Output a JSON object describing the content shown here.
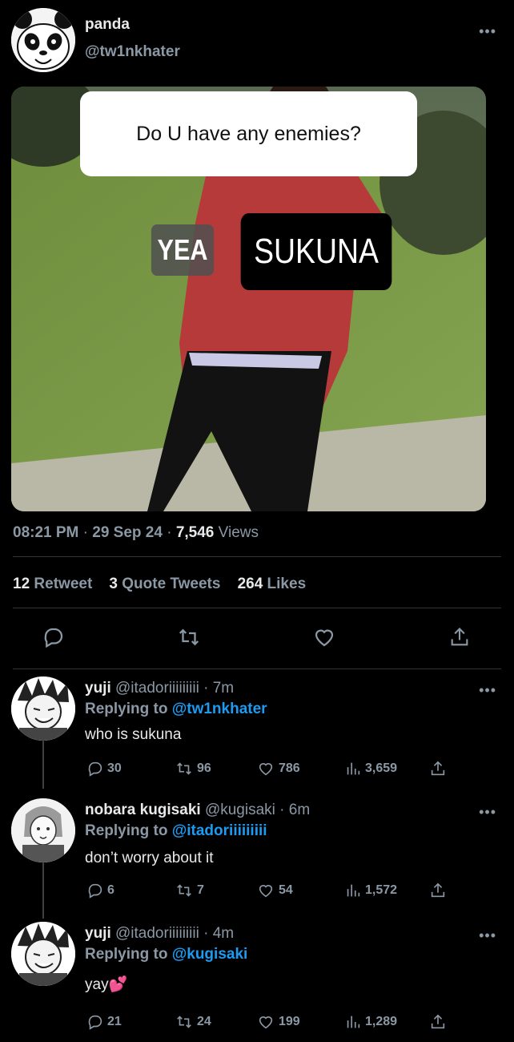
{
  "tweet": {
    "author_name": "panda",
    "author_handle": "@tw1nkhater",
    "media": {
      "question": "Do U have any enemies?",
      "answer_left": "YEA",
      "answer_right": "SUKUNA"
    },
    "time": "08:21 PM",
    "date": "29 Sep 24",
    "views_count": "7,546",
    "views_label": "Views",
    "retweets_count": "12",
    "retweets_label": "Retweet",
    "quotes_count": "3",
    "quotes_label": "Quote Tweets",
    "likes_count": "264",
    "likes_label": "Likes"
  },
  "replies": [
    {
      "name": "yuji",
      "handle": "@itadoriiiiiiiii",
      "time": "7m",
      "replying_label": "Replying to",
      "replying_to": "@tw1nkhater",
      "text": "who is sukuna",
      "replies": "30",
      "retweets": "96",
      "likes": "786",
      "views": "3,659"
    },
    {
      "name": "nobara kugisaki",
      "handle": "@kugisaki",
      "time": "6m",
      "replying_label": "Replying to",
      "replying_to": "@itadoriiiiiiiii",
      "text": "don’t worry about it",
      "replies": "6",
      "retweets": "7",
      "likes": "54",
      "views": "1,572"
    },
    {
      "name": "yuji",
      "handle": "@itadoriiiiiiiii",
      "time": "4m",
      "replying_label": "Replying to",
      "replying_to": "@kugisaki",
      "text": "yay💕",
      "replies": "21",
      "retweets": "24",
      "likes": "199",
      "views": "1,289"
    }
  ],
  "icons": {
    "more": "more-icon",
    "reply": "reply-icon",
    "retweet": "retweet-icon",
    "like": "heart-icon",
    "share": "share-icon",
    "views": "views-icon"
  },
  "colors": {
    "background": "#000000",
    "text": "#e7e9ea",
    "muted": "#8b98a5",
    "link": "#1d9bf0"
  }
}
